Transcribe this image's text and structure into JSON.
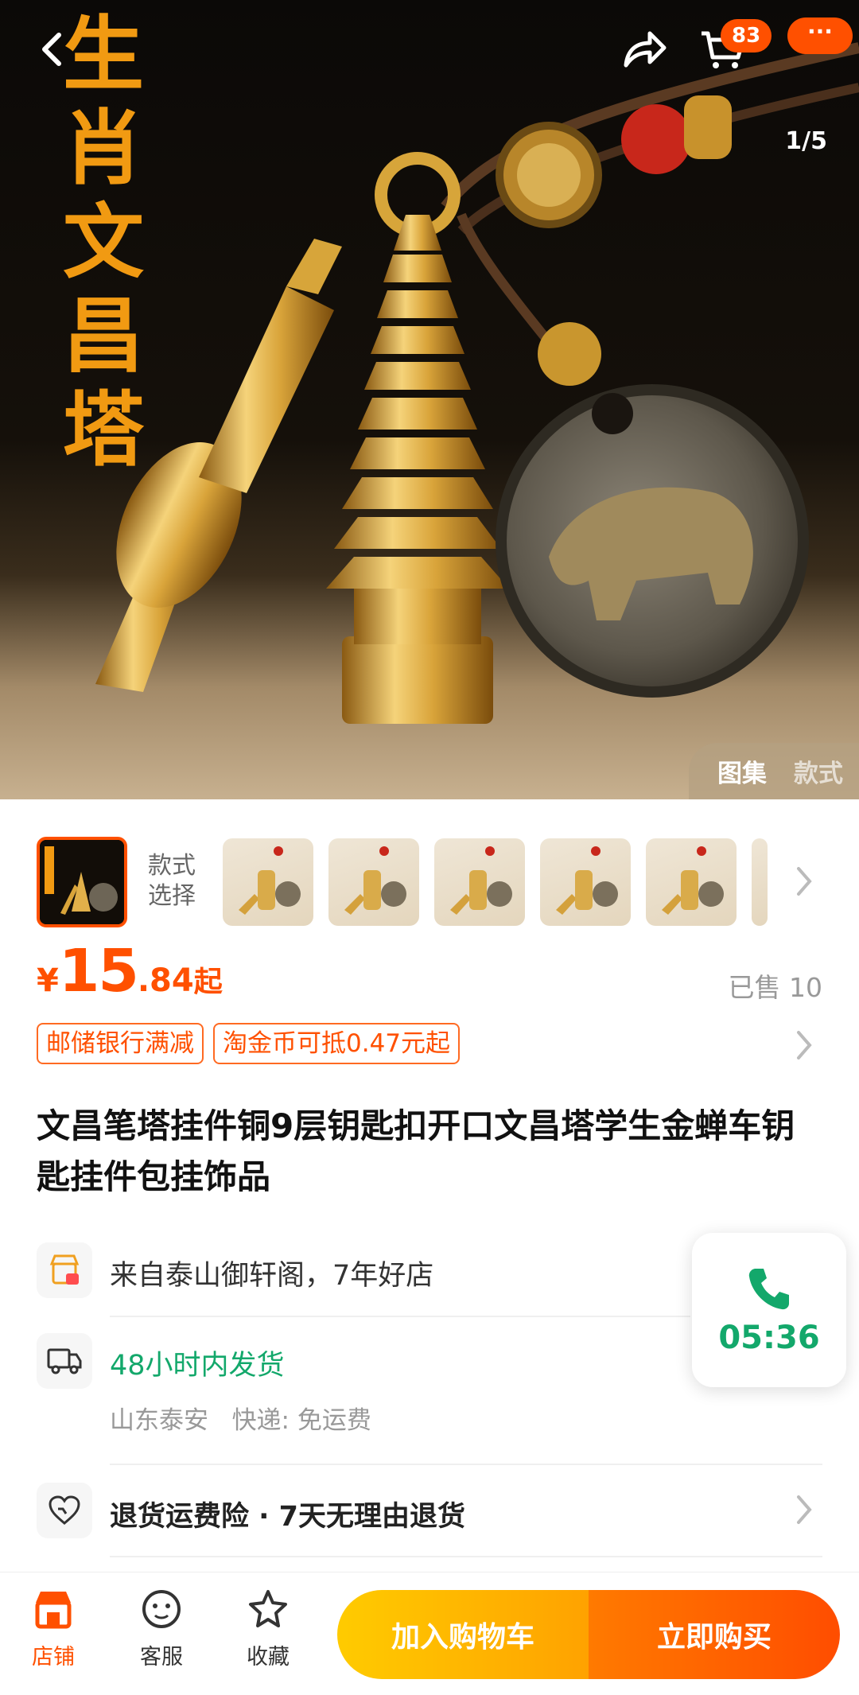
{
  "hero": {
    "banner_chars": [
      "生",
      "肖",
      "文",
      "昌",
      "塔"
    ],
    "cart_count": "83",
    "more_label": "···",
    "image_counter": "1/5",
    "gallery_tabs": [
      "图集",
      "款式"
    ]
  },
  "style_picker": {
    "label": "款式选择"
  },
  "price": {
    "currency": "¥",
    "integer": "15",
    "decimal": ".84",
    "suffix": "起",
    "sold": "已售 10"
  },
  "tags": [
    "邮储银行满减",
    "淘金币可抵0.47元起"
  ],
  "title": "文昌笔塔挂件铜9层钥匙扣开口文昌塔学生金蝉车钥匙挂件包挂饰品",
  "shop_info": "来自泰山御轩阁，7年好店",
  "shipping": {
    "time": "48小时内发货",
    "origin": "山东泰安",
    "courier": "快递: 免运费"
  },
  "returns": "退货运费险 · 7天无理由退货",
  "call_timer": "05:36",
  "bottom_nav": {
    "shop": "店铺",
    "service": "客服",
    "favorite": "收藏",
    "add_to_cart": "加入购物车",
    "buy_now": "立即购买"
  },
  "colors": {
    "accent": "#ff5000",
    "green": "#13a86b",
    "gold": "#f19a12"
  }
}
